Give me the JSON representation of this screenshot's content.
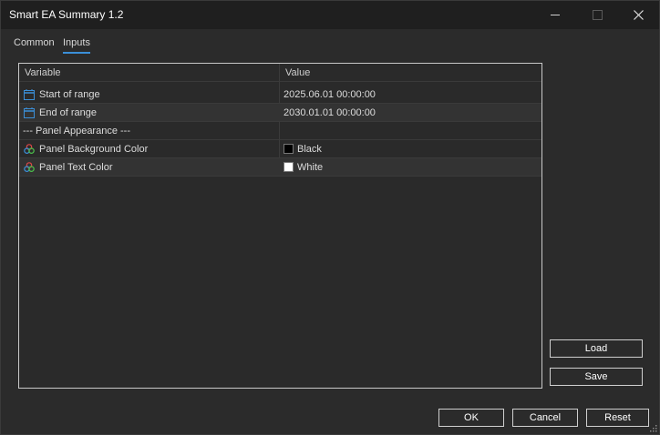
{
  "window": {
    "title": "Smart EA Summary 1.2"
  },
  "tabs": [
    {
      "label": "Common",
      "active": false
    },
    {
      "label": "Inputs",
      "active": true
    }
  ],
  "grid": {
    "columns": [
      "Variable",
      "Value"
    ],
    "rows": [
      {
        "variable": "Start of range",
        "value": "2025.06.01 00:00:00",
        "icon": "calendar-icon"
      },
      {
        "variable": "End of range",
        "value": "2030.01.01 00:00:00",
        "icon": "calendar-icon"
      },
      {
        "variable": "--- Panel Appearance ---",
        "value": "",
        "icon": ""
      },
      {
        "variable": "Panel Background Color",
        "value": "Black",
        "icon": "color-palette-icon",
        "swatch": "#000000"
      },
      {
        "variable": "Panel Text Color",
        "value": "White",
        "icon": "color-palette-icon",
        "swatch": "#ffffff"
      }
    ]
  },
  "buttons": {
    "load": "Load",
    "save": "Save",
    "ok": "OK",
    "cancel": "Cancel",
    "reset": "Reset"
  },
  "colors": {
    "accent": "#3b8fd8",
    "background": "#2b2b2b"
  }
}
